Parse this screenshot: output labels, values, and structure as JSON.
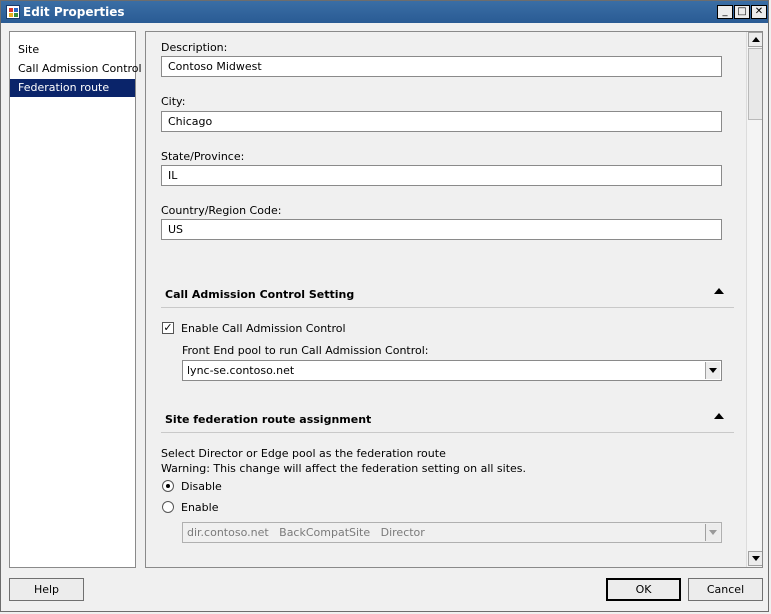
{
  "window": {
    "title": "Edit Properties"
  },
  "sidebar": {
    "items": [
      {
        "label": "Site"
      },
      {
        "label": "Call Admission Control"
      },
      {
        "label": "Federation route"
      }
    ]
  },
  "form": {
    "description": {
      "label": "Description:",
      "value": "Contoso Midwest"
    },
    "city": {
      "label": "City:",
      "value": "Chicago"
    },
    "state": {
      "label": "State/Province:",
      "value": "IL"
    },
    "country": {
      "label": "Country/Region Code:",
      "value": "US"
    }
  },
  "cac": {
    "title": "Call Admission Control Setting",
    "enable_label": "Enable Call Admission Control",
    "enable_checked": true,
    "pool_label": "Front End pool to run Call Admission Control:",
    "pool_value": "lync-se.contoso.net"
  },
  "federation": {
    "title": "Site federation route assignment",
    "info": "Select Director or Edge pool as the federation route",
    "warning": "Warning: This change will affect the federation setting on all sites.",
    "disable_label": "Disable",
    "enable_label": "Enable",
    "selected": "Disable",
    "route_value": "dir.contoso.net   BackCompatSite   Director"
  },
  "buttons": {
    "help": "Help",
    "ok": "OK",
    "cancel": "Cancel"
  }
}
